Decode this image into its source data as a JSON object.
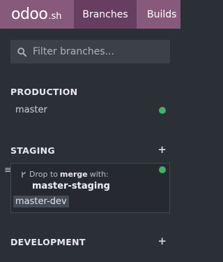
{
  "header": {
    "logo_main": "odoo",
    "logo_suffix": ".sh",
    "tabs": [
      {
        "label": "Branches",
        "active": true
      },
      {
        "label": "Builds",
        "active": false
      }
    ]
  },
  "search": {
    "placeholder": "Filter branches...",
    "value": ""
  },
  "sections": {
    "production": {
      "title": "PRODUCTION",
      "branches": [
        {
          "name": "master",
          "status": "green"
        }
      ]
    },
    "staging": {
      "title": "STAGING",
      "add_icon": "plus-icon",
      "drop_hint_prefix": "Drop to",
      "drop_hint_action": "merge",
      "drop_hint_suffix": "with:",
      "merge_target": "master-staging",
      "dragged_branch": "master-dev",
      "status": "green"
    },
    "development": {
      "title": "DEVELOPMENT",
      "add_icon": "plus-icon"
    }
  },
  "colors": {
    "brand": "#875a7b",
    "brand_dark": "#673e5f",
    "background": "#2b2f36",
    "status_green": "#3bb36b"
  }
}
